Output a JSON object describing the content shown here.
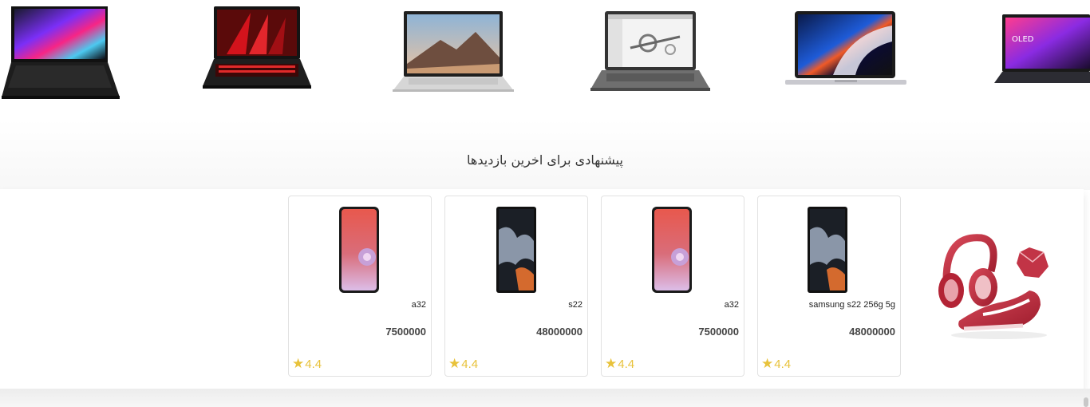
{
  "laptops": [
    {
      "icon": "laptop-rainbow-screen-icon"
    },
    {
      "icon": "laptop-red-keyboard-icon"
    },
    {
      "icon": "laptop-surface-landscape-icon"
    },
    {
      "icon": "laptop-cad-screen-icon"
    },
    {
      "icon": "laptop-macbook-icon"
    },
    {
      "icon": "laptop-oled-icon",
      "screen_text": "OLED"
    }
  ],
  "section": {
    "title": "پیشنهادی برای اخرین بازدیدها"
  },
  "products": [
    {
      "name": "samsung s22 256g 5g",
      "price": "48000000",
      "rating": "4.4",
      "image": "phone-s22-icon"
    },
    {
      "name": "a32",
      "price": "7500000",
      "rating": "4.4",
      "image": "phone-a32-icon"
    },
    {
      "name": "s22",
      "price": "48000000",
      "rating": "4.4",
      "image": "phone-s22-icon"
    },
    {
      "name": "a32",
      "price": "7500000",
      "rating": "4.4",
      "image": "phone-a32-icon"
    }
  ],
  "promo": {
    "image": "headphones-sneaker-promo-icon"
  },
  "colors": {
    "star": "#e8c23a",
    "promo": "#c0283c"
  }
}
